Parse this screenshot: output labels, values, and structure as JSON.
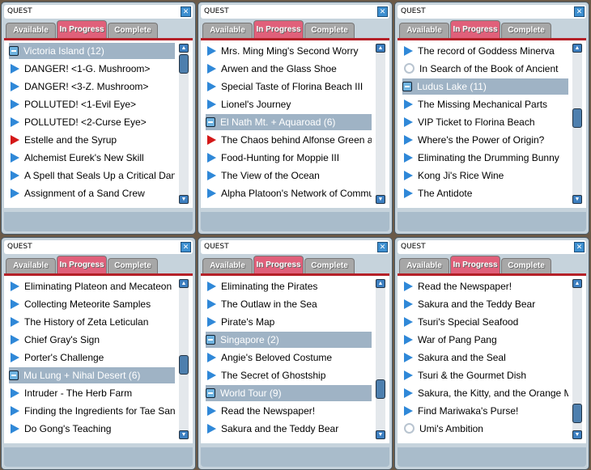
{
  "tabs": [
    "Available",
    "In Progress",
    "Complete"
  ],
  "panels": [
    {
      "title": "QUEST",
      "active_tab": 1,
      "scroll": 0.0,
      "rows": [
        {
          "t": "cat",
          "text": "Victoria Island (12)"
        },
        {
          "t": "q",
          "text": "DANGER! <1-G. Mushroom>"
        },
        {
          "t": "q",
          "text": "DANGER! <3-Z. Mushroom>"
        },
        {
          "t": "q",
          "text": "POLLUTED! <1-Evil Eye>"
        },
        {
          "t": "q",
          "text": "POLLUTED! <2-Curse Eye>"
        },
        {
          "t": "r",
          "text": "Estelle and the Syrup"
        },
        {
          "t": "q",
          "text": "Alchemist Eurek's New Skill"
        },
        {
          "t": "q",
          "text": "A Spell that Seals Up a Critical Dang"
        },
        {
          "t": "q",
          "text": "Assignment of a Sand Crew"
        }
      ]
    },
    {
      "title": "QUEST",
      "active_tab": 1,
      "scroll": null,
      "rows": [
        {
          "t": "q",
          "text": "Mrs. Ming Ming's Second Worry"
        },
        {
          "t": "q",
          "text": "Arwen and the Glass Shoe"
        },
        {
          "t": "q",
          "text": "Special Taste of Florina Beach III"
        },
        {
          "t": "q",
          "text": "Lionel's Journey"
        },
        {
          "t": "cat",
          "text": "El Nath Mt. + Aquaroad (6)"
        },
        {
          "t": "r",
          "text": "The Chaos behind Alfonse Green ar"
        },
        {
          "t": "q",
          "text": "Food-Hunting for Moppie III"
        },
        {
          "t": "q",
          "text": "The View of the Ocean"
        },
        {
          "t": "q",
          "text": "Alpha Platoon's Network of Commu"
        }
      ]
    },
    {
      "title": "QUEST",
      "active_tab": 1,
      "scroll": 0.45,
      "rows": [
        {
          "t": "q",
          "text": "The record of Goddess Minerva"
        },
        {
          "t": "c",
          "text": "In Search of the Book of Ancient"
        },
        {
          "t": "cat",
          "text": "Ludus Lake (11)"
        },
        {
          "t": "q",
          "text": "The Missing Mechanical Parts"
        },
        {
          "t": "q",
          "text": "VIP Ticket to Florina Beach"
        },
        {
          "t": "q",
          "text": "Where's the Power of Origin?"
        },
        {
          "t": "q",
          "text": "Eliminating the Drumming Bunny"
        },
        {
          "t": "q",
          "text": "Kong Ji's Rice Wine"
        },
        {
          "t": "q",
          "text": "The Antidote"
        }
      ]
    },
    {
      "title": "QUEST",
      "active_tab": 1,
      "scroll": 0.55,
      "rows": [
        {
          "t": "q",
          "text": "Eliminating Plateon and Mecateon"
        },
        {
          "t": "q",
          "text": "Collecting Meteorite Samples"
        },
        {
          "t": "q",
          "text": "The History of Zeta Leticulan"
        },
        {
          "t": "q",
          "text": "Chief Gray's Sign"
        },
        {
          "t": "q",
          "text": "Porter's Challenge"
        },
        {
          "t": "cat",
          "text": "Mu Lung + Nihal Desert (6)"
        },
        {
          "t": "q",
          "text": "Intruder - The Herb Farm"
        },
        {
          "t": "q",
          "text": "Finding the Ingredients for Tae Sang"
        },
        {
          "t": "q",
          "text": "Do Gong's Teaching"
        }
      ]
    },
    {
      "title": "QUEST",
      "active_tab": 1,
      "scroll": 0.75,
      "rows": [
        {
          "t": "q",
          "text": "Eliminating the Pirates"
        },
        {
          "t": "q",
          "text": "The Outlaw in the Sea"
        },
        {
          "t": "q",
          "text": "Pirate's Map"
        },
        {
          "t": "cat",
          "text": "Singapore (2)"
        },
        {
          "t": "q",
          "text": "Angie's Beloved Costume"
        },
        {
          "t": "q",
          "text": "The Secret of Ghostship"
        },
        {
          "t": "cat",
          "text": "World Tour (9)"
        },
        {
          "t": "q",
          "text": "Read the Newspaper!"
        },
        {
          "t": "q",
          "text": "Sakura and the Teddy Bear"
        }
      ]
    },
    {
      "title": "QUEST",
      "active_tab": 1,
      "scroll": 0.95,
      "rows": [
        {
          "t": "q",
          "text": "Read the Newspaper!"
        },
        {
          "t": "q",
          "text": "Sakura and the Teddy Bear"
        },
        {
          "t": "q",
          "text": "Tsuri's Special Seafood"
        },
        {
          "t": "q",
          "text": "War of Pang Pang"
        },
        {
          "t": "q",
          "text": "Sakura and the Seal"
        },
        {
          "t": "q",
          "text": "Tsuri & the Gourmet Dish"
        },
        {
          "t": "q",
          "text": "Sakura, the Kitty, and the Orange Ma"
        },
        {
          "t": "q",
          "text": "Find Mariwaka's Purse!"
        },
        {
          "t": "c",
          "text": "Umi's Ambition"
        }
      ]
    }
  ]
}
